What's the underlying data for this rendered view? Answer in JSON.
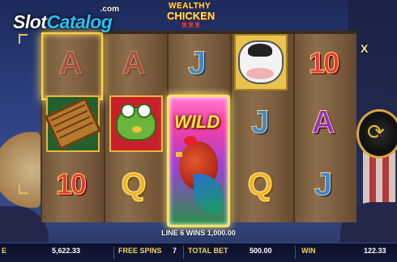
{
  "watermark": {
    "brand_slot": "Slot",
    "brand_catalog": "Catalog",
    "domain": ".com"
  },
  "game_title": {
    "line1": "WEALTHY",
    "line2": "CHICKEN",
    "line3": "发发发"
  },
  "reels": {
    "multiplier_label": "X",
    "wild_label": "WILD",
    "symbols": [
      [
        "A",
        "abacus",
        "10"
      ],
      [
        "A",
        "frog",
        "Q"
      ],
      [
        "J",
        "WILD",
        "WILD"
      ],
      [
        "cow",
        "J",
        "Q"
      ],
      [
        "10",
        "A",
        "J"
      ]
    ]
  },
  "win_line": "LINE 6 WINS 1,000.00",
  "status_bar": {
    "balance_label": "E",
    "balance_value": "5,622.33",
    "free_spins_label": "FREE SPINS",
    "free_spins_value": "7",
    "total_bet_label": "TOTAL BET",
    "total_bet_value": "500.00",
    "win_label": "WIN",
    "win_value": "122.33"
  },
  "colors": {
    "accent": "#f1d55b",
    "wild_glow": "#ffe066",
    "watermark_blue": "#28c1f5"
  }
}
